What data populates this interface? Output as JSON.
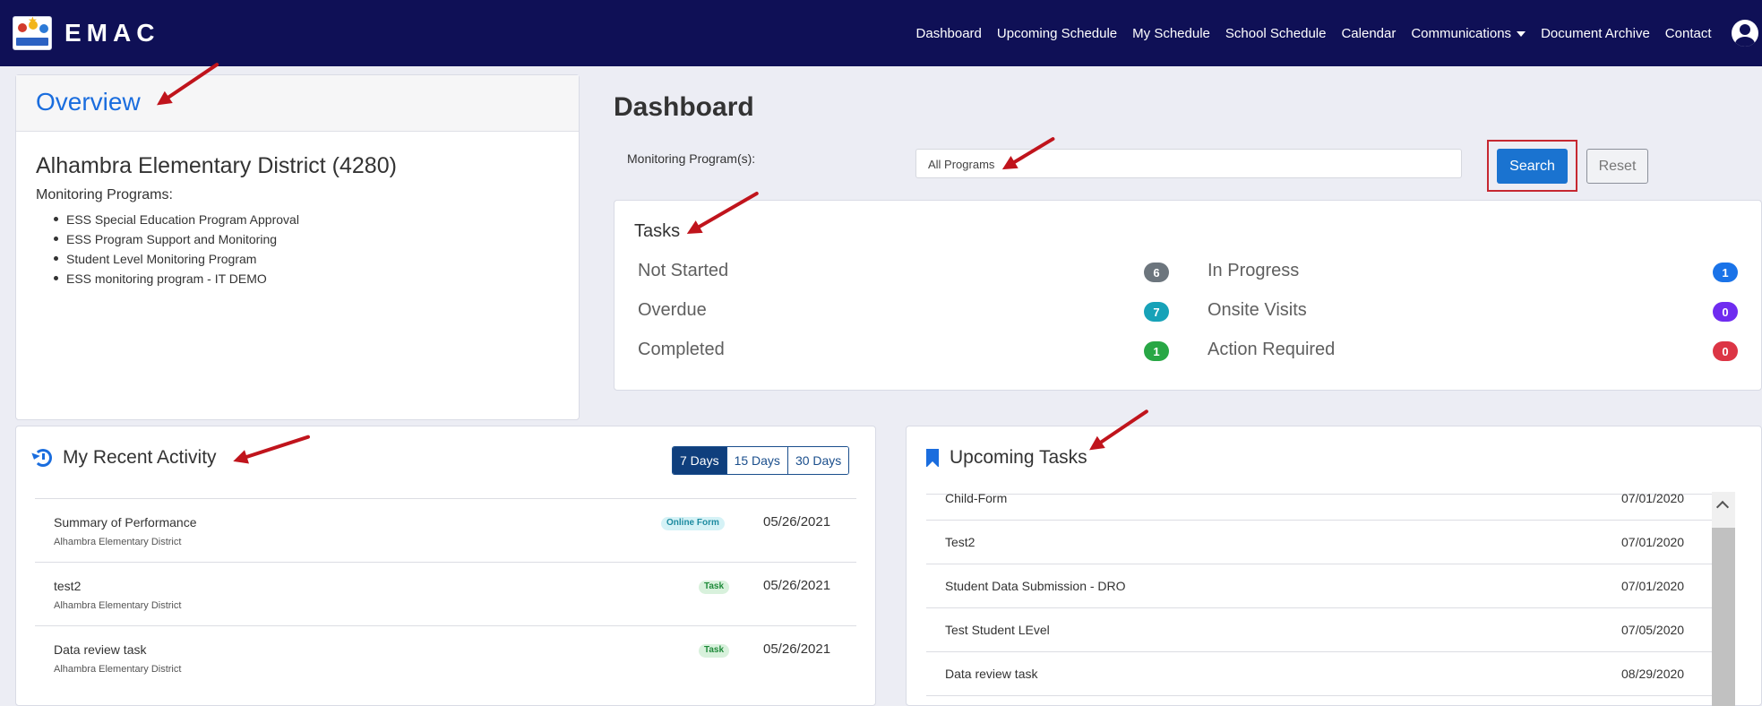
{
  "app": {
    "brand": "EMAC"
  },
  "nav": {
    "items": [
      "Dashboard",
      "Upcoming Schedule",
      "My Schedule",
      "School Schedule",
      "Calendar",
      "Communications",
      "Document Archive",
      "Contact"
    ]
  },
  "overview": {
    "title": "Overview",
    "district": "Alhambra Elementary District (4280)",
    "programs_label": "Monitoring Programs:",
    "programs": [
      "ESS Special Education Program Approval",
      "ESS Program Support and Monitoring",
      "Student Level Monitoring Program",
      "ESS monitoring program - IT DEMO"
    ]
  },
  "dashboard": {
    "title": "Dashboard",
    "monitoring_label": "Monitoring Program(s):",
    "program_select_value": "All Programs",
    "search_label": "Search",
    "reset_label": "Reset"
  },
  "tasks": {
    "title": "Tasks",
    "items": [
      {
        "label": "Not Started",
        "count": "6",
        "color": "#6c757d"
      },
      {
        "label": "Overdue",
        "count": "7",
        "color": "#17a2b8"
      },
      {
        "label": "Completed",
        "count": "1",
        "color": "#28a745"
      },
      {
        "label": "In Progress",
        "count": "1",
        "color": "#1a73e8"
      },
      {
        "label": "Onsite Visits",
        "count": "0",
        "color": "#6f2cf0"
      },
      {
        "label": "Action Required",
        "count": "0",
        "color": "#dc3545"
      }
    ]
  },
  "activity": {
    "title": "My Recent Activity",
    "ranges": [
      "7 Days",
      "15 Days",
      "30 Days"
    ],
    "active_range": "7 Days",
    "rows": [
      {
        "name": "Summary of Performance",
        "sub": "Alhambra Elementary District",
        "tag": "Online Form",
        "date": "05/26/2021"
      },
      {
        "name": "test2",
        "sub": "Alhambra Elementary District",
        "tag": "Task",
        "date": "05/26/2021"
      },
      {
        "name": "Data review task",
        "sub": "Alhambra Elementary District",
        "tag": "Task",
        "date": "05/26/2021"
      }
    ]
  },
  "upcoming": {
    "title": "Upcoming Tasks",
    "rows": [
      {
        "name": "Child-Form",
        "date": "07/01/2020"
      },
      {
        "name": "Test2",
        "date": "07/01/2020"
      },
      {
        "name": "Student Data Submission - DRO",
        "date": "07/01/2020"
      },
      {
        "name": "Test Student LEvel",
        "date": "07/05/2020"
      },
      {
        "name": "Data review task",
        "date": "08/29/2020"
      }
    ]
  },
  "colors": {
    "navbar": "#0f1056",
    "accent": "#1a6dde",
    "annotation_arrow": "#c0141c"
  }
}
